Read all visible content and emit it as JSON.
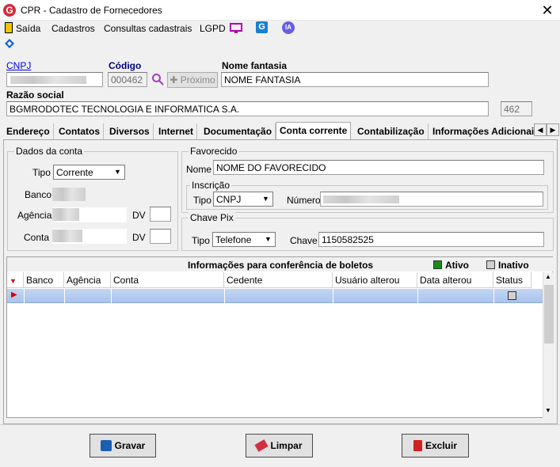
{
  "window": {
    "title": "CPR - Cadastro de Fornecedores",
    "app_icon_letter": "G"
  },
  "menu": {
    "items": [
      "Saída",
      "Cadastros",
      "Consultas cadastrais",
      "LGPD"
    ],
    "ia_label": "IA"
  },
  "header": {
    "cnpj_label": "CNPJ",
    "codigo_label": "Código",
    "codigo_value": "000462",
    "proximo_label": "Próximo",
    "nome_fantasia_label": "Nome fantasia",
    "nome_fantasia_value": "NOME FANTASIA",
    "razao_social_label": "Razão social",
    "razao_social_value": "BGMRODOTEC TECNOLOGIA E INFORMATICA S.A.",
    "side_code": "462"
  },
  "tabs": [
    "Endereço",
    "Contatos",
    "Diversos",
    "Internet",
    "Documentação",
    "Conta corrente",
    "Contabilização",
    "Informações Adicionais"
  ],
  "active_tab": "Conta corrente",
  "dados_conta": {
    "title": "Dados da conta",
    "tipo_label": "Tipo",
    "tipo_value": "Corrente",
    "banco_label": "Banco",
    "agencia_label": "Agência",
    "conta_label": "Conta",
    "dv_label": "DV"
  },
  "favorecido": {
    "title": "Favorecido",
    "nome_label": "Nome",
    "nome_value": "NOME DO FAVORECIDO",
    "inscricao_title": "Inscrição",
    "tipo_label": "Tipo",
    "tipo_value": "CNPJ",
    "numero_label": "Número"
  },
  "chave_pix": {
    "title": "Chave Pix",
    "tipo_label": "Tipo",
    "tipo_value": "Telefone",
    "chave_label": "Chave",
    "chave_value": "1150582525"
  },
  "grid": {
    "title": "Informações para conferência de boletos",
    "legend_ativo": "Ativo",
    "legend_inativo": "Inativo",
    "columns": [
      "Banco",
      "Agência",
      "Conta",
      "Cedente",
      "Usuário alterou",
      "Data alterou",
      "Status"
    ]
  },
  "buttons": {
    "gravar": "Gravar",
    "limpar": "Limpar",
    "excluir": "Excluir"
  },
  "colors": {
    "accent_red": "#d52b3a",
    "link_blue": "#0000ee",
    "ativo_green": "#1a8a1a",
    "selection": "#b3cbf0"
  }
}
